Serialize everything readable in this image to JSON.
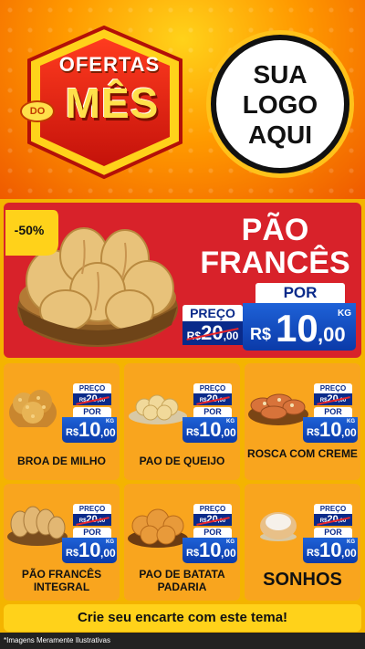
{
  "header": {
    "badge_top": "OFERTAS",
    "badge_do": "DO",
    "badge_main": "MÊS",
    "logo_lines": [
      "SUA",
      "LOGO",
      "AQUI"
    ]
  },
  "featured": {
    "discount": "-50%",
    "title_line1": "PÃO",
    "title_line2": "FRANCÊS",
    "preco_label": "PREÇO",
    "old_currency": "R$",
    "old_int": "20",
    "old_dec": ",00",
    "por_label": "POR",
    "new_currency": "R$",
    "new_int": "10",
    "new_dec": ",00",
    "unit": "KG"
  },
  "products": [
    {
      "name": "BROA DE MILHO",
      "preco_label": "PREÇO",
      "old_currency": "R$",
      "old_int": "20",
      "old_dec": ",00",
      "por_label": "POR",
      "new_currency": "R$",
      "new_int": "10",
      "new_dec": ",00",
      "unit": "KG",
      "icon": "broa-icon"
    },
    {
      "name": "PAO DE QUEIJO",
      "preco_label": "PREÇO",
      "old_currency": "R$",
      "old_int": "20",
      "old_dec": ",00",
      "por_label": "POR",
      "new_currency": "R$",
      "new_int": "10",
      "new_dec": ",00",
      "unit": "KG",
      "icon": "pao-de-queijo-icon"
    },
    {
      "name": "ROSCA COM CREME",
      "preco_label": "PREÇO",
      "old_currency": "R$",
      "old_int": "20",
      "old_dec": ",00",
      "por_label": "POR",
      "new_currency": "R$",
      "new_int": "10",
      "new_dec": ",00",
      "unit": "KG",
      "icon": "rosca-icon"
    },
    {
      "name": "PÃO FRANCÊS INTEGRAL",
      "preco_label": "PREÇO",
      "old_currency": "R$",
      "old_int": "20",
      "old_dec": ",00",
      "por_label": "POR",
      "new_currency": "R$",
      "new_int": "10",
      "new_dec": ",00",
      "unit": "KG",
      "icon": "pao-integral-icon"
    },
    {
      "name": "PAO DE BATATA PADARIA",
      "preco_label": "PREÇO",
      "old_currency": "R$",
      "old_int": "20",
      "old_dec": ",00",
      "por_label": "POR",
      "new_currency": "R$",
      "new_int": "10",
      "new_dec": ",00",
      "unit": "KG",
      "icon": "pao-de-batata-icon"
    },
    {
      "name": "SONHOS",
      "preco_label": "PREÇO",
      "old_currency": "R$",
      "old_int": "20",
      "old_dec": ",00",
      "por_label": "POR",
      "new_currency": "R$",
      "new_int": "10",
      "new_dec": ",00",
      "unit": "KG",
      "icon": "sonho-icon"
    }
  ],
  "footer": {
    "cta": "Crie seu encarte com este tema!",
    "disclaimer": "*Imagens Meramente Ilustrativas"
  },
  "colors": {
    "header_red": "#d8222a",
    "card_orange": "#f9a51e",
    "price_blue": "#0b3aa8",
    "footer_yellow": "#ffd21a"
  }
}
